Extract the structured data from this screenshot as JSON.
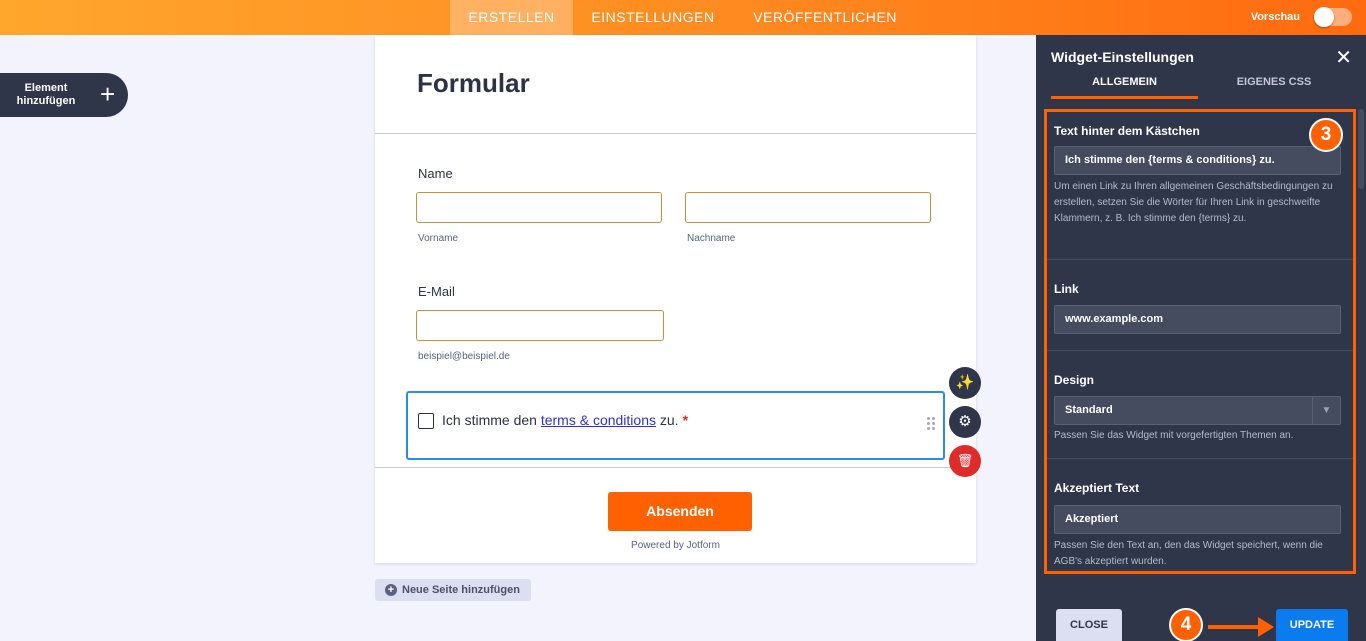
{
  "topbar": {
    "tabs": [
      {
        "label": "ERSTELLEN",
        "active": true
      },
      {
        "label": "EINSTELLUNGEN",
        "active": false
      },
      {
        "label": "VERÖFFENTLICHEN",
        "active": false
      }
    ],
    "preview_label": "Vorschau",
    "preview_on": false
  },
  "add_element": {
    "label": "Element hinzufügen",
    "icon": "plus-icon"
  },
  "form": {
    "title": "Formular",
    "name_label": "Name",
    "first_sublabel": "Vorname",
    "last_sublabel": "Nachname",
    "email_label": "E-Mail",
    "email_sublabel": "beispiel@beispiel.de",
    "consent": {
      "before": "Ich stimme den ",
      "link": "terms & conditions",
      "after": " zu.",
      "required": "*"
    },
    "submit_label": "Absenden",
    "powered_by": "Powered by Jotform"
  },
  "tools": {
    "wand_icon": "✨",
    "gear_icon": "⚙",
    "trash_icon": "🗑"
  },
  "new_page_label": "Neue Seite hinzufügen",
  "panel": {
    "title": "Widget-Einstellungen",
    "close_icon": "✕",
    "tabs": [
      {
        "label": "ALLGEMEIN",
        "active": true
      },
      {
        "label": "EIGENES CSS",
        "active": false
      }
    ],
    "text_section": {
      "label": "Text hinter dem Kästchen",
      "value": "Ich stimme den {terms & conditions} zu.",
      "help": "Um einen Link zu Ihren allgemeinen Geschäftsbedingungen zu erstellen, setzen Sie die Wörter für Ihren Link in geschweifte Klammern, z. B. Ich stimme den {terms} zu."
    },
    "link_section": {
      "label": "Link",
      "value": "www.example.com"
    },
    "design_section": {
      "label": "Design",
      "value": "Standard",
      "help": "Passen Sie das Widget mit vorgefertigten Themen an."
    },
    "accepted_section": {
      "label": "Akzeptiert Text",
      "value": "Akzeptiert",
      "help": "Passen Sie den Text an, den das Widget speichert, wenn die AGB's akzeptiert wurden."
    },
    "close_label": "CLOSE",
    "update_label": "UPDATE"
  },
  "annotations": {
    "step3": "3",
    "step4": "4"
  },
  "colors": {
    "accent": "#ff6100",
    "panel": "#2f3649",
    "update": "#0a7cf0",
    "focus": "#2e8ae5"
  }
}
